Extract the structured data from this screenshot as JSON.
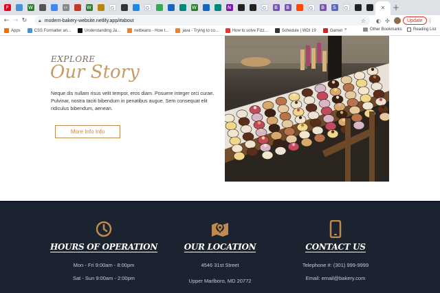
{
  "browser": {
    "tabs": [
      {
        "icon": "pinterest-icon",
        "color": "#e60023",
        "glyph": "P"
      },
      {
        "icon": "site-icon",
        "color": "#4a90d9",
        "glyph": ""
      },
      {
        "icon": "w-icon",
        "color": "#2e7d32",
        "glyph": "W"
      },
      {
        "icon": "eye-icon",
        "color": "#555555",
        "glyph": ""
      },
      {
        "icon": "folder-icon",
        "color": "#4285f4",
        "glyph": ""
      },
      {
        "icon": "code-icon",
        "color": "#888888",
        "glyph": "‹›"
      },
      {
        "icon": "flag-icon",
        "color": "#c0392b",
        "glyph": ""
      },
      {
        "icon": "w-icon",
        "color": "#2e7d32",
        "glyph": "W"
      },
      {
        "icon": "bars-icon",
        "color": "#b8860b",
        "glyph": ""
      },
      {
        "icon": "google-icon",
        "color": "#ffffff",
        "glyph": "G"
      },
      {
        "icon": "moon-icon",
        "color": "#333333",
        "glyph": ""
      },
      {
        "icon": "sync-icon",
        "color": "#1e88e5",
        "glyph": ""
      },
      {
        "icon": "google-icon",
        "color": "#ffffff",
        "glyph": "G"
      },
      {
        "icon": "map-pin-icon",
        "color": "#34a853",
        "glyph": ""
      },
      {
        "icon": "image-icon",
        "color": "#1565c0",
        "glyph": ""
      },
      {
        "icon": "diamond-icon",
        "color": "#00897b",
        "glyph": ""
      },
      {
        "icon": "w-icon",
        "color": "#2e7d32",
        "glyph": "W"
      },
      {
        "icon": "image-icon",
        "color": "#1565c0",
        "glyph": ""
      },
      {
        "icon": "diamond-icon",
        "color": "#00897b",
        "glyph": ""
      },
      {
        "icon": "onenote-icon",
        "color": "#7719aa",
        "glyph": "N"
      },
      {
        "icon": "github-icon",
        "color": "#222222",
        "glyph": ""
      },
      {
        "icon": "github-icon",
        "color": "#222222",
        "glyph": ""
      },
      {
        "icon": "google-icon",
        "color": "#ffffff",
        "glyph": "G"
      },
      {
        "icon": "bootstrap-icon",
        "color": "#7952b3",
        "glyph": "B"
      },
      {
        "icon": "bootstrap-icon",
        "color": "#7952b3",
        "glyph": "B"
      },
      {
        "icon": "reddit-icon",
        "color": "#ff4500",
        "glyph": ""
      },
      {
        "icon": "google-icon",
        "color": "#ffffff",
        "glyph": "G"
      },
      {
        "icon": "bootstrap-icon",
        "color": "#7952b3",
        "glyph": "B"
      },
      {
        "icon": "s-icon",
        "color": "#5c6bc0",
        "glyph": "S"
      },
      {
        "icon": "google-icon",
        "color": "#ffffff",
        "glyph": "G"
      },
      {
        "icon": "github-icon",
        "color": "#222222",
        "glyph": ""
      },
      {
        "icon": "github-icon",
        "color": "#222222",
        "glyph": ""
      }
    ],
    "active_tab_glyph": "✕",
    "new_tab": "+",
    "url": "modern-bakery-website.netlify.app/#about",
    "update_label": "Update",
    "bookmarks": [
      {
        "label": "Apps",
        "color": "#e8710a"
      },
      {
        "label": "CSS Formatter an...",
        "color": "#4a90d9"
      },
      {
        "label": "Understanding Ja...",
        "color": "#111111"
      },
      {
        "label": "netbeans - How t...",
        "color": "#f48024"
      },
      {
        "label": "java - Trying to co...",
        "color": "#f48024"
      },
      {
        "label": "How to solve Fizz...",
        "color": "#e53935"
      },
      {
        "label": "Schedule | WDI 19",
        "color": "#333333"
      },
      {
        "label": "Garnet",
        "color": "#c62828"
      }
    ],
    "bookmarks_overflow": "»",
    "other_bookmarks": "Other Bookmarks",
    "reading_list": "Reading List"
  },
  "story": {
    "eyebrow": "EXPLORE",
    "heading": "Our Story",
    "body": "Neque dis nullam risus velit tempor, eros diam. Posuere integer orci curae. Pulvinar, nostra taciti bibendum in penatibus augue. Sem consequat elit ridiculus bibendum, aenean.",
    "button": "More Info Info"
  },
  "footer": {
    "hours": {
      "title": "HOURS OF OPERATION",
      "line1": "Mon - Fri 9:00am - 8:00pm",
      "line2": "Sat - Sun 9:00am - 2:00pm",
      "icon": "clock-icon"
    },
    "location": {
      "title": "OUR LOCATION",
      "line1": "4546 31st Street",
      "line2": "Upper Marlboro, MD 20772",
      "icon": "map-icon"
    },
    "contact": {
      "title": "CONTACT US",
      "line1": "Telephone #: (301) 999-9999",
      "line2": "Email: email@bakery.com",
      "icon": "phone-icon"
    }
  },
  "colors": {
    "accent": "#c59a63",
    "button_border": "#c08a4e",
    "footer_bg": "#1b2331",
    "icon": "#c08a4e"
  }
}
